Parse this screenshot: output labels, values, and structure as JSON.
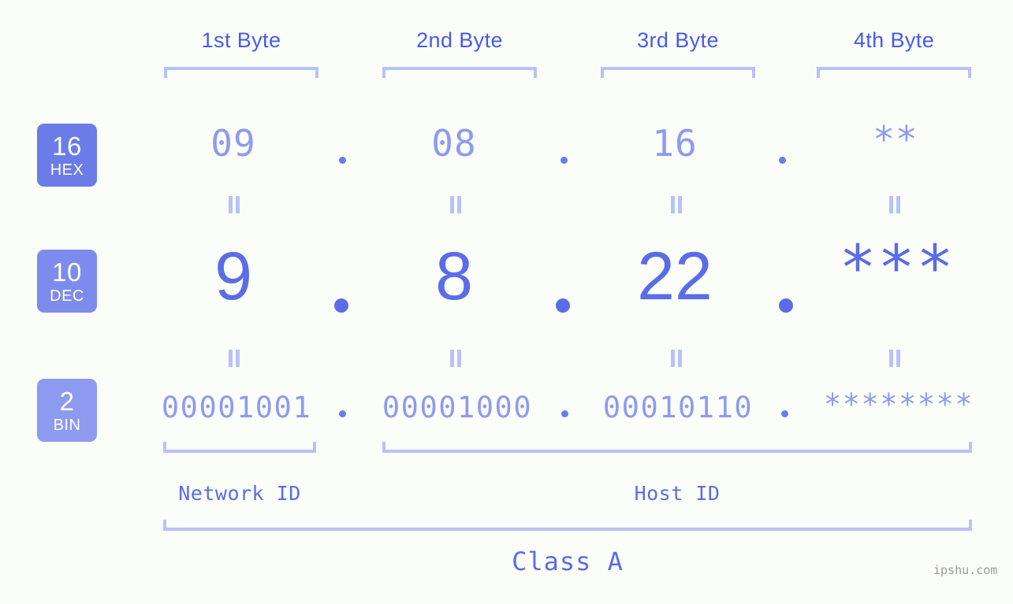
{
  "background_color": "#fbfdf8",
  "colors": {
    "header_blue": "#4a5ae8",
    "bracket_blue": "#b9c2f7",
    "light_value_blue": "#8f9bef",
    "strong_value_blue": "#5a6ce8",
    "badge_hex": "#6b7ce8",
    "badge_dec": "#7d8cec",
    "badge_bin": "#8c9bf0",
    "watermark_gray": "#9a9a9a"
  },
  "byte_headers": [
    {
      "label": "1st Byte"
    },
    {
      "label": "2nd Byte"
    },
    {
      "label": "3rd Byte"
    },
    {
      "label": "4th Byte"
    }
  ],
  "bases": [
    {
      "number": "16",
      "abbr": "HEX"
    },
    {
      "number": "10",
      "abbr": "DEC"
    },
    {
      "number": "2",
      "abbr": "BIN"
    }
  ],
  "rows": {
    "hex": {
      "values": [
        "09",
        "08",
        "16",
        "**"
      ]
    },
    "dec": {
      "values": [
        "9",
        "8",
        "22",
        "***"
      ]
    },
    "bin": {
      "values": [
        "00001001",
        "00001000",
        "00010110",
        "********"
      ]
    }
  },
  "separator": ".",
  "equality_symbol": "=",
  "sections": {
    "network_id": "Network ID",
    "host_id": "Host ID",
    "class": "Class A"
  },
  "watermark": "ipshu.com"
}
